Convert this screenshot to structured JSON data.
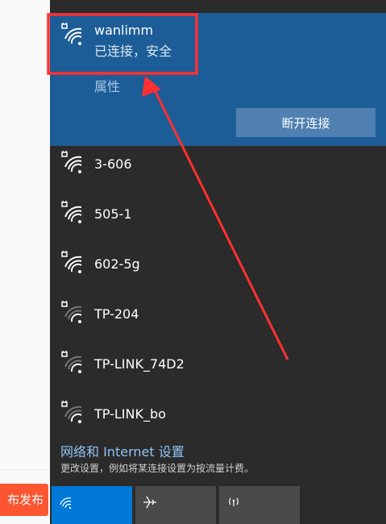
{
  "background_page": {
    "publish_label": "布发布"
  },
  "active_network": {
    "name": "wanlimm",
    "status": "已连接，安全",
    "properties_label": "属性",
    "disconnect_label": "断开连接"
  },
  "networks": [
    {
      "name": "3-606",
      "signal": "strong"
    },
    {
      "name": "505-1",
      "signal": "strong"
    },
    {
      "name": "602-5g",
      "signal": "strong"
    },
    {
      "name": "TP-204",
      "signal": "weak"
    },
    {
      "name": "TP-LINK_74D2",
      "signal": "weak"
    },
    {
      "name": "TP-LINK_bo",
      "signal": "weak"
    }
  ],
  "settings": {
    "link_label": "网络和 Internet 设置",
    "description": "更改设置，例如将某连接设置为按流量计费。"
  },
  "quick_actions": [
    {
      "name": "wifi",
      "icon": "wifi-icon",
      "active": true
    },
    {
      "name": "airplane",
      "icon": "airplane-icon",
      "active": false
    },
    {
      "name": "hotspot",
      "icon": "hotspot-icon",
      "active": false
    }
  ],
  "colors": {
    "active_bg": "#1c5d97",
    "panel_bg": "#2b2b2b",
    "accent": "#0078d7",
    "publish_button": "#fc5531",
    "link": "#8fc3f5"
  }
}
